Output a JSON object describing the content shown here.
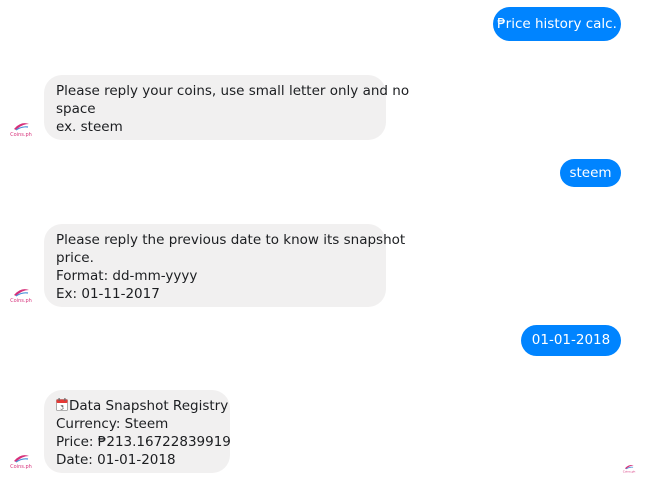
{
  "messages": {
    "m1": {
      "text": "₱rice history calc."
    },
    "m2": {
      "lines": [
        "Please reply your coins, use small letter only and no",
        "space",
        "ex. steem"
      ]
    },
    "m3": {
      "text": "steem"
    },
    "m4": {
      "lines": [
        "Please reply the previous date to know its snapshot",
        "price.",
        "Format: dd-mm-yyyy",
        "Ex: 01-11-2017"
      ]
    },
    "m5": {
      "text": "01-01-2018"
    },
    "m6": {
      "icon": "calendar-icon",
      "lines": [
        "Data Snapshot Registry",
        "Currency: Steem",
        "Price: ₱213.16722839919",
        "Date: 01-01-2018"
      ]
    }
  },
  "bot": {
    "avatar_icon": "coinsph-logo-icon",
    "avatar_text": "Coins.ph"
  },
  "colors": {
    "outgoing": "#0084ff",
    "incoming": "#f1f0f0",
    "logo_pink": "#d6307a",
    "logo_blue": "#4a90d9"
  }
}
